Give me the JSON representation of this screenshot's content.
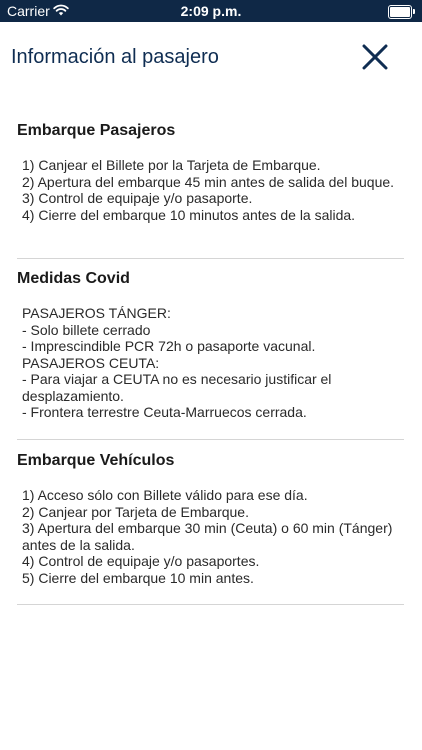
{
  "status_bar": {
    "carrier": "Carrier",
    "time": "2:09 p.m.",
    "wifi_icon": "wifi-icon",
    "battery_icon": "battery-icon",
    "battery_level": 1.0
  },
  "header": {
    "title": "Información al pasajero",
    "close_icon": "close-icon",
    "accent_color": "#0f2d52"
  },
  "sections": [
    {
      "title": "Embarque Pasajeros",
      "body": "1) Canjear el Billete por la Tarjeta de Embarque.\n2) Apertura del embarque 45 min antes de salida del buque.\n3) Control de equipaje y/o pasaporte.\n4) Cierre del embarque 10 minutos antes de la salida."
    },
    {
      "title": "Medidas Covid",
      "body": "PASAJEROS TÁNGER:\n- Solo billete cerrado\n- Imprescindible PCR 72h o pasaporte vacunal.\nPASAJEROS CEUTA:\n- Para viajar a CEUTA no es necesario justificar el desplazamiento.\n- Frontera terrestre Ceuta-Marruecos cerrada."
    },
    {
      "title": "Embarque Vehículos",
      "body": "1) Acceso sólo con Billete válido para ese día.\n2) Canjear por Tarjeta de Embarque.\n3) Apertura del embarque 30 min (Ceuta) o 60 min (Tánger) antes de la salida.\n4) Control de equipaje y/o pasaportes.\n5) Cierre del embarque 10 min antes."
    }
  ]
}
